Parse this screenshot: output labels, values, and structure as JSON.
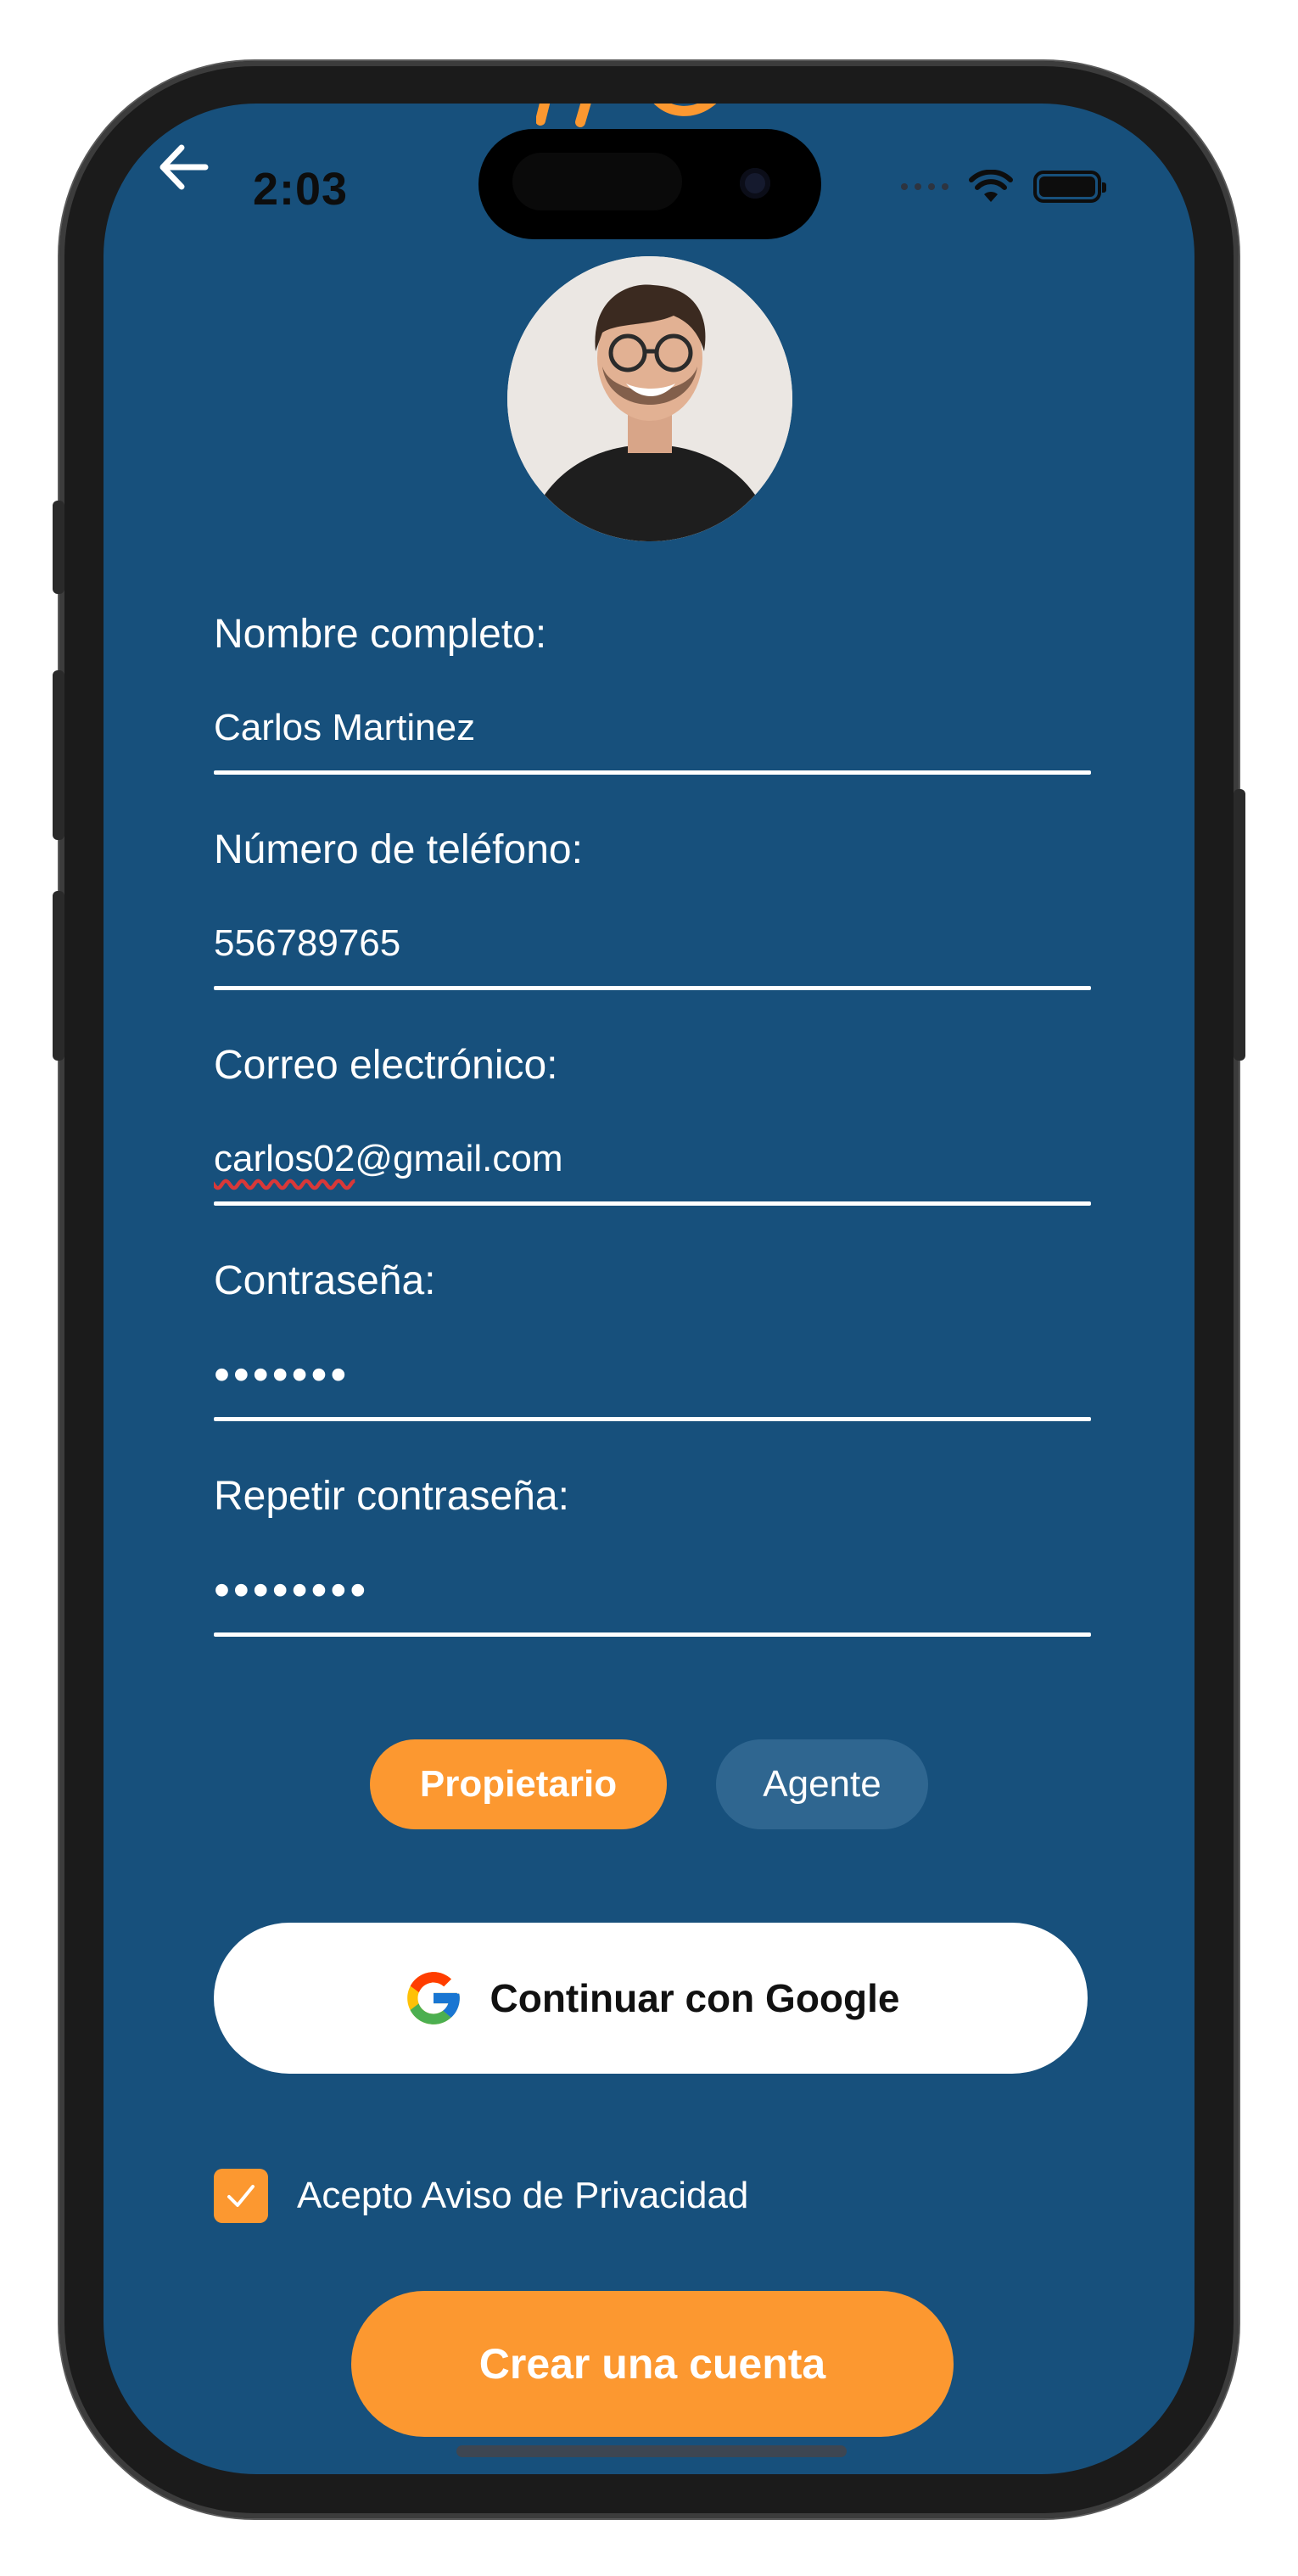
{
  "status_bar": {
    "time": "2:03",
    "icons": [
      "cellular-dots-icon",
      "wifi-icon",
      "battery-icon"
    ]
  },
  "nav": {
    "back_icon": "arrow-left-icon"
  },
  "profile": {
    "avatar": "profile-photo"
  },
  "form": {
    "full_name": {
      "label": "Nombre completo:",
      "value": "Carlos Martinez"
    },
    "phone": {
      "label": "Número de teléfono:",
      "value": "556789765"
    },
    "email": {
      "label": "Correo electrónico:",
      "value_underlined": "carlos02",
      "value_rest": "@gmail.com"
    },
    "password": {
      "label": "Contraseña:",
      "value": "•••••••"
    },
    "repeat_password": {
      "label": "Repetir contraseña:",
      "value": "••••••••"
    }
  },
  "role": {
    "selected": "Propietario",
    "options": [
      "Propietario",
      "Agente"
    ]
  },
  "google_button": {
    "label": "Continuar con Google",
    "icon": "google-g-icon"
  },
  "privacy": {
    "checked": true,
    "label": "Acepto Aviso de Privacidad"
  },
  "submit": {
    "label": "Crear una cuenta"
  },
  "colors": {
    "background": "#17507c",
    "accent": "#fc9830",
    "secondary_pill": "#2f6690",
    "text": "#ffffff"
  }
}
